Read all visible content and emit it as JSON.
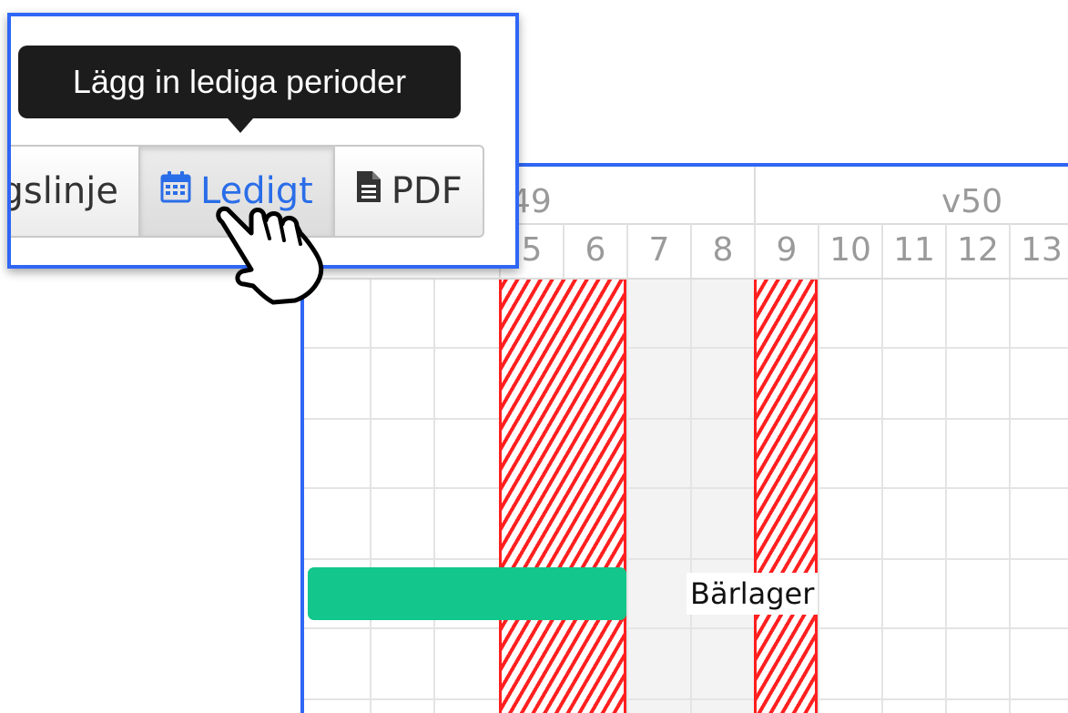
{
  "toolbar": {
    "tooltip_text": "Lägg in lediga perioder",
    "timeline_label": "gslinje",
    "ledigt_label": "Ledigt",
    "pdf_label": "PDF",
    "icons": {
      "calendar": "calendar-icon",
      "pdf": "file-icon"
    }
  },
  "gantt": {
    "weeks": [
      "49",
      "v50"
    ],
    "days": [
      "5",
      "6",
      "7",
      "8",
      "9",
      "10",
      "11",
      "12",
      "13"
    ],
    "task_label": "Bärlager"
  },
  "colors": {
    "callout_border": "#2f66f5",
    "task_bar": "#13c68b",
    "holiday_stripe": "#ff2020",
    "link_blue": "#2a6de8"
  }
}
